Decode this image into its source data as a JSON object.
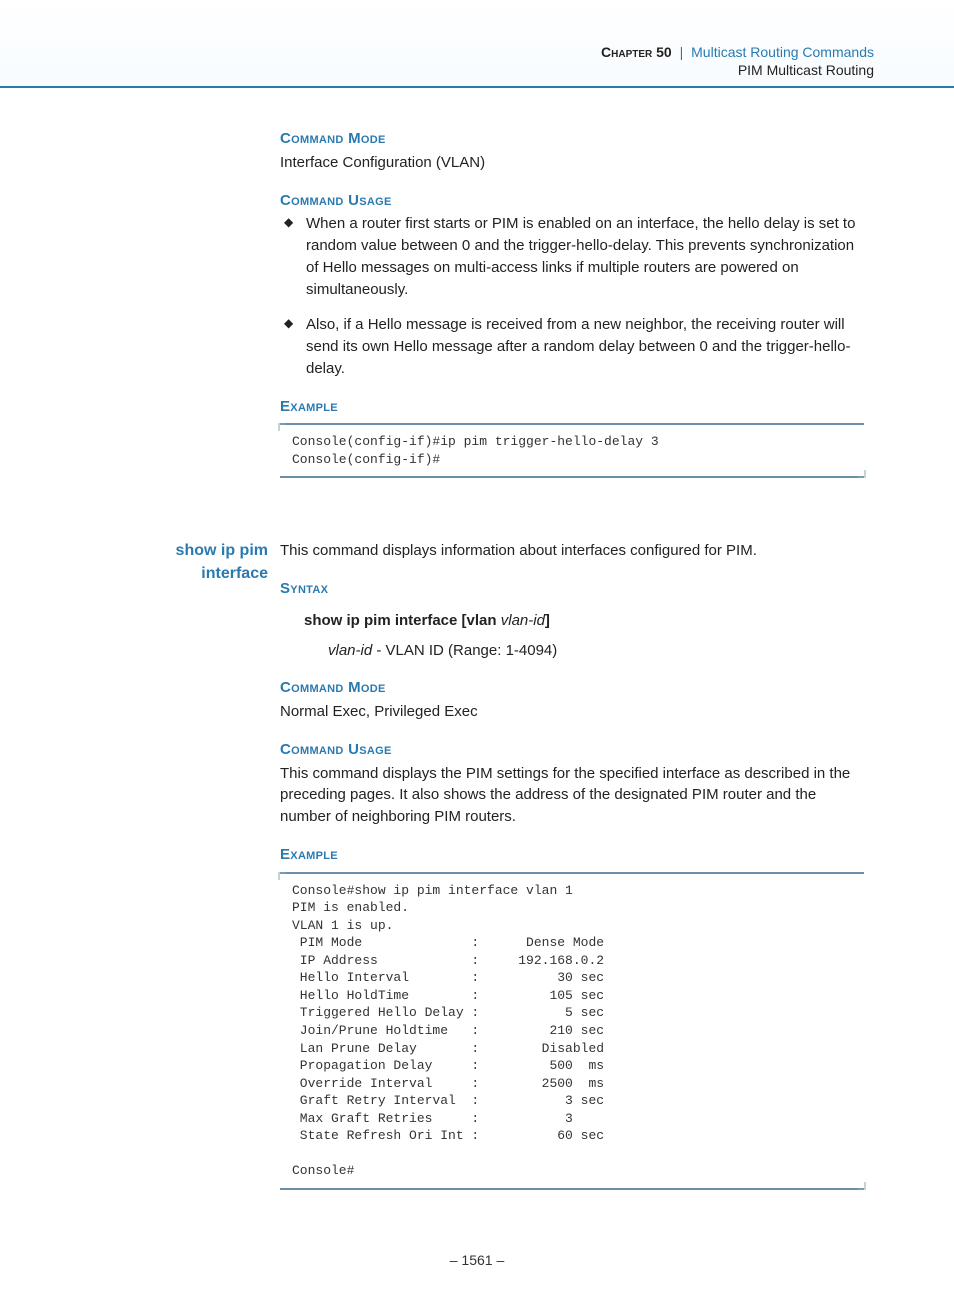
{
  "header": {
    "chapter_label": "Chapter 50",
    "separator": "|",
    "title": "Multicast Routing Commands",
    "subtitle": "PIM Multicast Routing"
  },
  "sec1": {
    "h_mode": "Command Mode",
    "mode_text": "Interface Configuration (VLAN)",
    "h_usage": "Command Usage",
    "usage_bullets": [
      "When a router first starts or PIM is enabled on an interface, the hello delay is set to random value between 0 and the trigger-hello-delay. This prevents synchronization of Hello messages on multi-access links if multiple routers are powered on simultaneously.",
      "Also, if a Hello message is received from a new neighbor, the receiving router will send its own Hello message after a random delay between 0 and the trigger-hello-delay."
    ],
    "h_example": "Example",
    "example_code": "Console(config-if)#ip pim trigger-hello-delay 3\nConsole(config-if)#"
  },
  "sec2": {
    "cmd_name_l1": "show ip pim",
    "cmd_name_l2": "interface",
    "intro": "This command displays information about interfaces configured for PIM.",
    "h_syntax": "Syntax",
    "syntax_bold1": "show ip pim interface",
    "syntax_bold2": "vlan",
    "syntax_opt": "vlan-id",
    "syntax_sub_i": "vlan-id",
    "syntax_sub_rest": " - VLAN ID (Range: 1-4094)",
    "h_mode": "Command Mode",
    "mode_text": "Normal Exec, Privileged Exec",
    "h_usage": "Command Usage",
    "usage_text": "This command displays the PIM settings for the specified interface as described in the preceding pages. It also shows the address of the designated PIM router and the number of neighboring PIM routers.",
    "h_example": "Example",
    "example_code": "Console#show ip pim interface vlan 1\nPIM is enabled.\nVLAN 1 is up.\n PIM Mode              :      Dense Mode\n IP Address            :     192.168.0.2\n Hello Interval        :          30 sec\n Hello HoldTime        :         105 sec\n Triggered Hello Delay :           5 sec\n Join/Prune Holdtime   :         210 sec\n Lan Prune Delay       :        Disabled\n Propagation Delay     :         500  ms\n Override Interval     :        2500  ms\n Graft Retry Interval  :           3 sec\n Max Graft Retries     :           3\n State Refresh Ori Int :          60 sec\n\nConsole#"
  },
  "footer": {
    "page": "– 1561 –"
  }
}
